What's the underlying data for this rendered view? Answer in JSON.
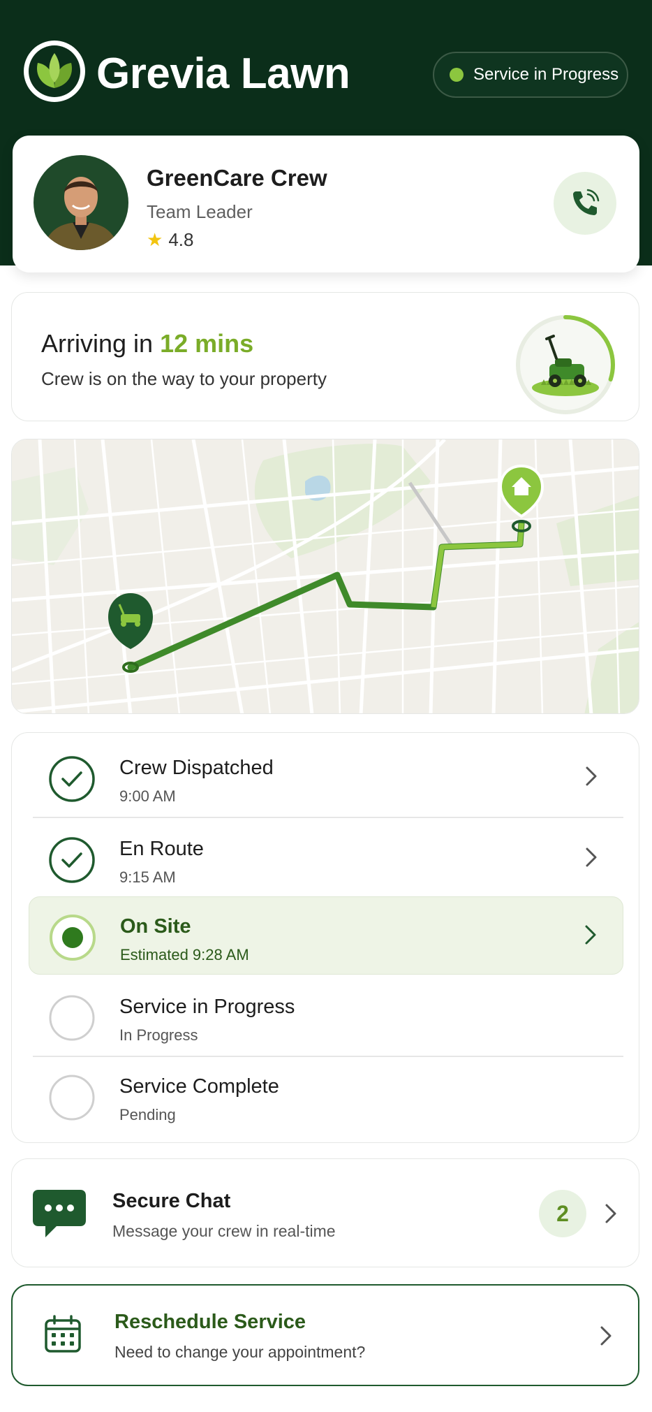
{
  "header": {
    "app_title": "Grevia Lawn",
    "status_label": "Service in Progress",
    "logo_icon": "leaf-logo-icon"
  },
  "crew": {
    "name": "GreenCare Crew",
    "role": "Team Leader",
    "rating": "4.8",
    "call_icon": "phone-icon"
  },
  "eta": {
    "prefix": "Arriving in",
    "value": "12 mins",
    "subtitle": "Crew is on the way to your property",
    "progress_fraction": 0.3
  },
  "map": {
    "start_marker_icon": "lawn-mower-marker-icon",
    "destination_marker_icon": "home-marker-icon"
  },
  "timeline": {
    "steps": [
      {
        "title": "Crew Dispatched",
        "time": "9:00 AM",
        "state": "done"
      },
      {
        "title": "En Route",
        "time": "9:15 AM",
        "state": "done"
      },
      {
        "title": "On Site",
        "time": "Estimated 9:28 AM",
        "state": "active"
      },
      {
        "title": "Service in Progress",
        "time": "In Progress",
        "state": "pending"
      },
      {
        "title": "Service Complete",
        "time": "Pending",
        "state": "pending"
      }
    ]
  },
  "chat": {
    "title": "Secure Chat",
    "subtitle": "Message your crew in real-time",
    "unread_count": "2"
  },
  "reschedule": {
    "title": "Reschedule Service",
    "subtitle": "Need to change your appointment?"
  },
  "colors": {
    "header_bg": "#0b2e1a",
    "accent_green": "#7aac28",
    "dark_green": "#1f5a2e",
    "status_dot": "#8cc63f"
  }
}
